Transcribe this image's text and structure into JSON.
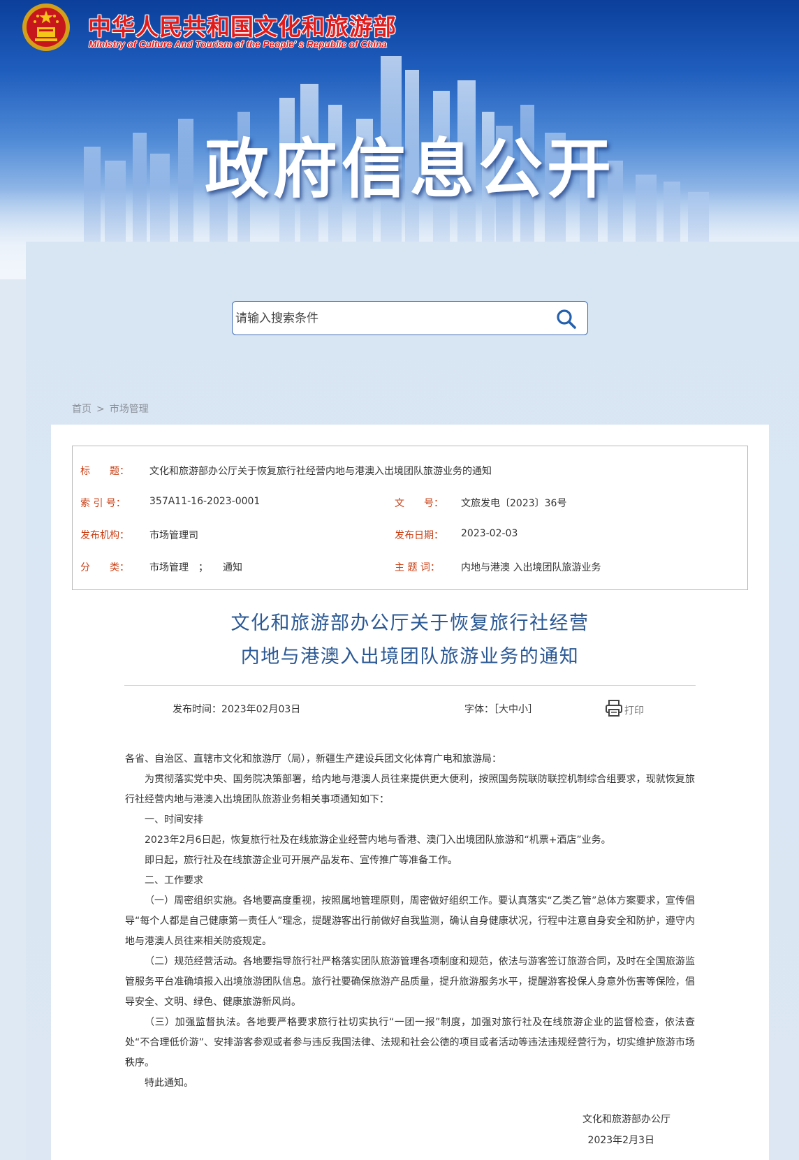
{
  "header": {
    "site_name_cn": "中华人民共和国文化和旅游部",
    "site_name_en": "Ministry of Culture And Tourism of the People' s Republic of China",
    "banner_title": "政府信息公开",
    "colors": {
      "brand_red": "#e21b1b",
      "banner_blue": "#1f5dbd"
    }
  },
  "search": {
    "placeholder": "请输入搜索条件",
    "icon": "search-icon"
  },
  "breadcrumb": {
    "home": "首页",
    "separator": ">",
    "current": "市场管理"
  },
  "meta": {
    "title_label": "标　　题：",
    "title_value": "文化和旅游部办公厅关于恢复旅行社经营内地与港澳入出境团队旅游业务的通知",
    "index_label": "索 引 号：",
    "index_value": "357A11-16-2023-0001",
    "docno_label": "文　　号：",
    "docno_value": "文旅发电〔2023〕36号",
    "org_label": "发布机构：",
    "org_value": "市场管理司",
    "date_label": "发布日期：",
    "date_value": "2023-02-03",
    "category_label": "分　　类：",
    "category_value": "市场管理　；　　通知",
    "subject_label": "主 题 词：",
    "subject_value": "内地与港澳 入出境团队旅游业务"
  },
  "article": {
    "title_line1": "文化和旅游部办公厅关于恢复旅行社经营",
    "title_line2": "内地与港澳入出境团队旅游业务的通知",
    "publish_time": "发布时间：2023年02月03日",
    "font_size_label": "字体：［大中小］",
    "print_label": "打印",
    "paragraphs": [
      "各省、自治区、直辖市文化和旅游厅（局），新疆生产建设兵团文化体育广电和旅游局：",
      "为贯彻落实党中央、国务院决策部署，给内地与港澳人员往来提供更大便利，按照国务院联防联控机制综合组要求，现就恢复旅行社经营内地与港澳入出境团队旅游业务相关事项通知如下：",
      "一、时间安排",
      "2023年2月6日起，恢复旅行社及在线旅游企业经营内地与香港、澳门入出境团队旅游和“机票+酒店”业务。",
      "即日起，旅行社及在线旅游企业可开展产品发布、宣传推广等准备工作。",
      "二、工作要求",
      "（一）周密组织实施。各地要高度重视，按照属地管理原则，周密做好组织工作。要认真落实“乙类乙管”总体方案要求，宣传倡导“每个人都是自己健康第一责任人”理念，提醒游客出行前做好自我监测，确认自身健康状况，行程中注意自身安全和防护，遵守内地与港澳人员往来相关防疫规定。",
      "（二）规范经营活动。各地要指导旅行社严格落实团队旅游管理各项制度和规范，依法与游客签订旅游合同，及时在全国旅游监管服务平台准确填报入出境旅游团队信息。旅行社要确保旅游产品质量，提升旅游服务水平，提醒游客投保人身意外伤害等保险，倡导安全、文明、绿色、健康旅游新风尚。",
      "（三）加强监督执法。各地要严格要求旅行社切实执行“一团一报”制度，加强对旅行社及在线旅游企业的监督检查，依法查处“不合理低价游”、安排游客参观或者参与违反我国法律、法规和社会公德的项目或者活动等违法违规经营行为，切实维护旅游市场秩序。",
      "特此通知。"
    ],
    "signature_org": "文化和旅游部办公厅",
    "signature_date": "2023年2月3日"
  }
}
